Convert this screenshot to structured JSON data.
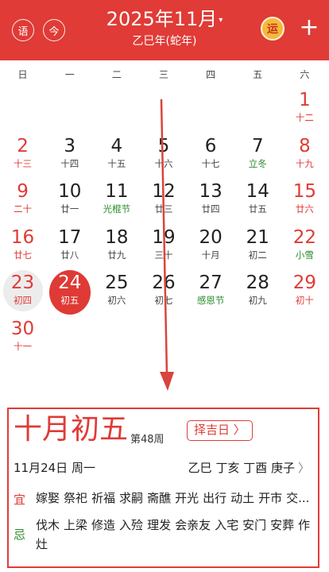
{
  "header": {
    "lang_button": "语",
    "today_button": "今",
    "title": "2025年11月",
    "caret": "▾",
    "subtitle": "乙巳年(蛇年)",
    "logo_char": "运",
    "add_button": "+",
    "bg_color": "#e03b36"
  },
  "weekdays": [
    "日",
    "一",
    "二",
    "三",
    "四",
    "五",
    "六"
  ],
  "days": [
    {
      "num": "1",
      "sub": "十二",
      "type": "lunar",
      "col": 6,
      "row": 0,
      "weekend": true
    },
    {
      "num": "2",
      "sub": "十三",
      "type": "lunar",
      "col": 0,
      "row": 1,
      "weekend": true
    },
    {
      "num": "3",
      "sub": "十四",
      "type": "lunar",
      "col": 1,
      "row": 1
    },
    {
      "num": "4",
      "sub": "十五",
      "type": "lunar",
      "col": 2,
      "row": 1
    },
    {
      "num": "5",
      "sub": "十六",
      "type": "lunar",
      "col": 3,
      "row": 1
    },
    {
      "num": "6",
      "sub": "十七",
      "type": "lunar",
      "col": 4,
      "row": 1
    },
    {
      "num": "7",
      "sub": "立冬",
      "type": "term",
      "col": 5,
      "row": 1
    },
    {
      "num": "8",
      "sub": "十九",
      "type": "lunar",
      "col": 6,
      "row": 1,
      "weekend": true
    },
    {
      "num": "9",
      "sub": "二十",
      "type": "lunar",
      "col": 0,
      "row": 2,
      "weekend": true
    },
    {
      "num": "10",
      "sub": "廿一",
      "type": "lunar",
      "col": 1,
      "row": 2
    },
    {
      "num": "11",
      "sub": "光棍节",
      "type": "festival",
      "col": 2,
      "row": 2
    },
    {
      "num": "12",
      "sub": "廿三",
      "type": "lunar",
      "col": 3,
      "row": 2
    },
    {
      "num": "13",
      "sub": "廿四",
      "type": "lunar",
      "col": 4,
      "row": 2
    },
    {
      "num": "14",
      "sub": "廿五",
      "type": "lunar",
      "col": 5,
      "row": 2
    },
    {
      "num": "15",
      "sub": "廿六",
      "type": "lunar",
      "col": 6,
      "row": 2,
      "weekend": true
    },
    {
      "num": "16",
      "sub": "廿七",
      "type": "lunar",
      "col": 0,
      "row": 3,
      "weekend": true
    },
    {
      "num": "17",
      "sub": "廿八",
      "type": "lunar",
      "col": 1,
      "row": 3
    },
    {
      "num": "18",
      "sub": "廿九",
      "type": "lunar",
      "col": 2,
      "row": 3
    },
    {
      "num": "19",
      "sub": "三十",
      "type": "lunar",
      "col": 3,
      "row": 3
    },
    {
      "num": "20",
      "sub": "十月",
      "type": "lunar",
      "col": 4,
      "row": 3
    },
    {
      "num": "21",
      "sub": "初二",
      "type": "lunar",
      "col": 5,
      "row": 3
    },
    {
      "num": "22",
      "sub": "小雪",
      "type": "term",
      "col": 6,
      "row": 3,
      "weekend": true
    },
    {
      "num": "23",
      "sub": "初四",
      "type": "lunar",
      "col": 0,
      "row": 4,
      "weekend": true,
      "today": true
    },
    {
      "num": "24",
      "sub": "初五",
      "type": "lunar",
      "col": 1,
      "row": 4,
      "selected": true
    },
    {
      "num": "25",
      "sub": "初六",
      "type": "lunar",
      "col": 2,
      "row": 4
    },
    {
      "num": "26",
      "sub": "初七",
      "type": "lunar",
      "col": 3,
      "row": 4
    },
    {
      "num": "27",
      "sub": "感恩节",
      "type": "festival",
      "col": 4,
      "row": 4
    },
    {
      "num": "28",
      "sub": "初九",
      "type": "lunar",
      "col": 5,
      "row": 4
    },
    {
      "num": "29",
      "sub": "初十",
      "type": "lunar",
      "col": 6,
      "row": 4,
      "weekend": true
    },
    {
      "num": "30",
      "sub": "十一",
      "type": "lunar",
      "col": 0,
      "row": 5,
      "weekend": true
    }
  ],
  "detail": {
    "lunar_date": "十月初五",
    "week_no": "第48周",
    "pick_button": "择吉日 〉",
    "solar_date": "11月24日 周一",
    "ganzhi": "乙巳  丁亥  丁酉  庚子",
    "ganzhi_chevron": "〉",
    "yi_label": "宜",
    "ji_label": "忌",
    "yi_items": [
      "嫁娶",
      "祭祀",
      "祈福",
      "求嗣",
      "斋醮",
      "开光",
      "出行",
      "动土",
      "开市",
      "交..."
    ],
    "ji_items": [
      "伐木",
      "上梁",
      "修造",
      "入殓",
      "理发",
      "会亲友",
      "入宅",
      "安门",
      "安葬",
      "作灶"
    ]
  }
}
